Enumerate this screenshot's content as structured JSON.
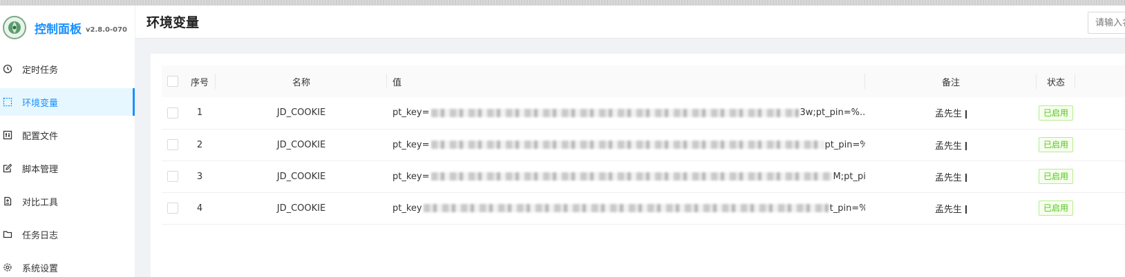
{
  "app": {
    "title": "控制面板",
    "version": "v2.8.0-070"
  },
  "sidebar": {
    "items": [
      {
        "label": "定时任务",
        "icon": "clock-icon",
        "active": false
      },
      {
        "label": "环境变量",
        "icon": "select-icon",
        "active": true
      },
      {
        "label": "配置文件",
        "icon": "control-icon",
        "active": false
      },
      {
        "label": "脚本管理",
        "icon": "form-edit-icon",
        "active": false
      },
      {
        "label": "对比工具",
        "icon": "diff-icon",
        "active": false
      },
      {
        "label": "任务日志",
        "icon": "folder-icon",
        "active": false
      },
      {
        "label": "系统设置",
        "icon": "setting-icon",
        "active": false
      }
    ]
  },
  "header": {
    "page_title": "环境变量",
    "search_placeholder": "请输入名称或者关键词"
  },
  "table": {
    "columns": {
      "index": "序号",
      "name": "名称",
      "value": "值",
      "remark": "备注",
      "status": "状态"
    },
    "rows": [
      {
        "index": "1",
        "name": "JD_COOKIE",
        "value_prefix": "pt_key=",
        "value_suffix": "3w;pt_pin=%...",
        "remark": "孟先生",
        "status": "已启用"
      },
      {
        "index": "2",
        "name": "JD_COOKIE",
        "value_prefix": "pt_key=",
        "value_suffix": "pt_pin=%...",
        "remark": "孟先生",
        "status": "已启用"
      },
      {
        "index": "3",
        "name": "JD_COOKIE",
        "value_prefix": "pt_key=",
        "value_suffix": "M;pt_pi...",
        "remark": "孟先生",
        "status": "已启用"
      },
      {
        "index": "4",
        "name": "JD_COOKIE",
        "value_prefix": "pt_key",
        "value_suffix": "t_pin=%E...",
        "remark": "孟先生",
        "status": "已启用"
      }
    ]
  },
  "colors": {
    "accent": "#1890ff",
    "active_bg": "#e6f7ff",
    "success": "#52c41a"
  }
}
